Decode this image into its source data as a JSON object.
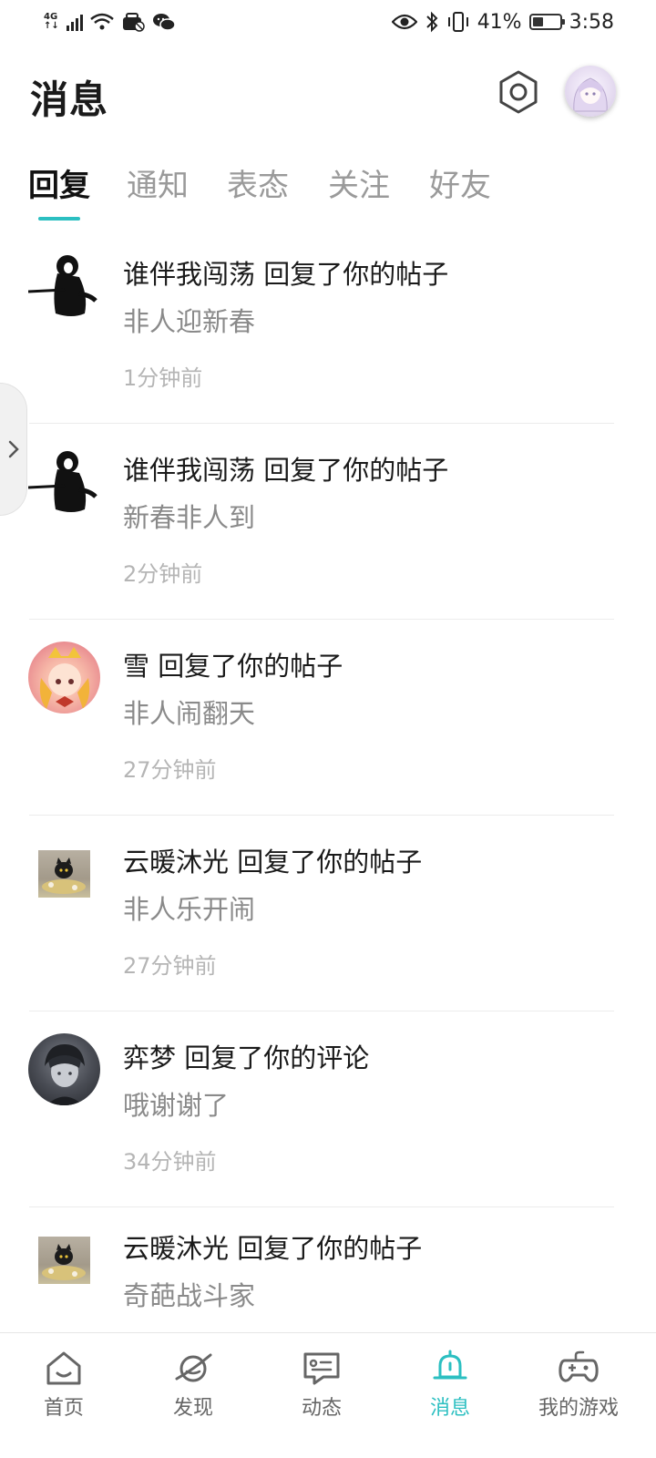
{
  "status_bar": {
    "network": "4G",
    "battery": "41%",
    "battery_level": 0.41,
    "time": "3:58"
  },
  "header": {
    "title": "消息"
  },
  "tabs": [
    {
      "label": "回复",
      "active": true
    },
    {
      "label": "通知",
      "active": false
    },
    {
      "label": "表态",
      "active": false
    },
    {
      "label": "关注",
      "active": false
    },
    {
      "label": "好友",
      "active": false
    }
  ],
  "messages": [
    {
      "title": "谁伴我闯荡 回复了你的帖子",
      "preview": "非人迎新春",
      "time": "1分钟前"
    },
    {
      "title": "谁伴我闯荡 回复了你的帖子",
      "preview": "新春非人到",
      "time": "2分钟前"
    },
    {
      "title": "雪 回复了你的帖子",
      "preview": "非人闹翻天",
      "time": "27分钟前"
    },
    {
      "title": "云暖沐光 回复了你的帖子",
      "preview": "非人乐开闹",
      "time": "27分钟前"
    },
    {
      "title": "弈梦 回复了你的评论",
      "preview": "哦谢谢了",
      "time": "34分钟前"
    },
    {
      "title": "云暖沐光 回复了你的帖子",
      "preview": "奇葩战斗家",
      "time": ""
    }
  ],
  "bottom_nav": [
    {
      "label": "首页",
      "icon": "home-icon",
      "active": false
    },
    {
      "label": "发现",
      "icon": "planet-icon",
      "active": false
    },
    {
      "label": "动态",
      "icon": "chat-icon",
      "active": false
    },
    {
      "label": "消息",
      "icon": "bell-icon",
      "active": true
    },
    {
      "label": "我的游戏",
      "icon": "gamepad-icon",
      "active": false
    }
  ],
  "colors": {
    "accent": "#2bbfc1",
    "text_primary": "#1a1a1a",
    "text_secondary": "#8a8a8a",
    "text_time": "#b5b5b5"
  }
}
